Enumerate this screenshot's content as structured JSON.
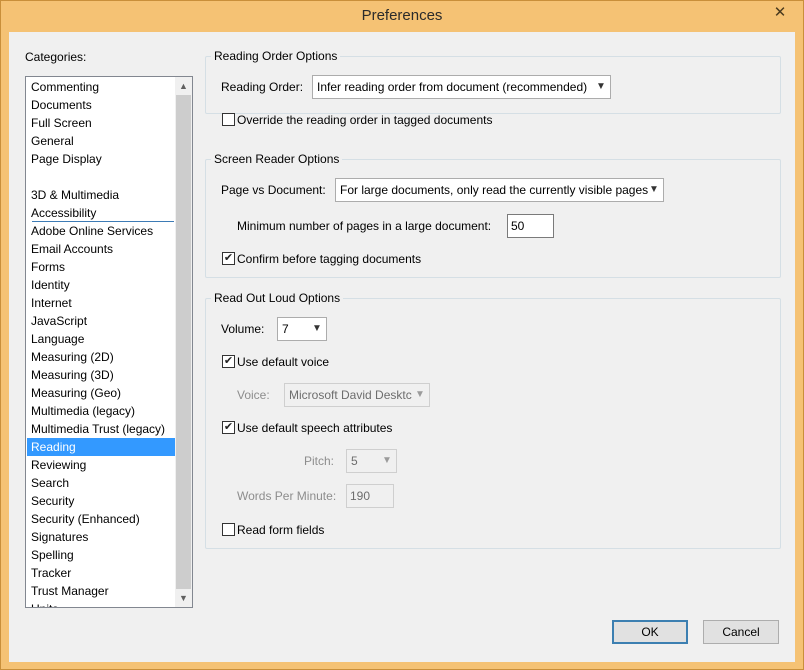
{
  "window": {
    "title": "Preferences",
    "close_icon": "close-icon"
  },
  "categories": {
    "label": "Categories:",
    "top_items": [
      "Commenting",
      "Documents",
      "Full Screen",
      "General",
      "Page Display"
    ],
    "items": [
      "3D & Multimedia",
      "Accessibility",
      "Adobe Online Services",
      "Email Accounts",
      "Forms",
      "Identity",
      "Internet",
      "JavaScript",
      "Language",
      "Measuring (2D)",
      "Measuring (3D)",
      "Measuring (Geo)",
      "Multimedia (legacy)",
      "Multimedia Trust (legacy)",
      "Reading",
      "Reviewing",
      "Search",
      "Security",
      "Security (Enhanced)",
      "Signatures",
      "Spelling",
      "Tracker",
      "Trust Manager",
      "Units"
    ],
    "selected": "Reading"
  },
  "reading_order": {
    "group_title": "Reading Order Options",
    "label": "Reading Order:",
    "value": "Infer reading order from document (recommended)",
    "override_label": "Override the reading order in tagged documents",
    "override_checked": false
  },
  "screen_reader": {
    "group_title": "Screen Reader Options",
    "page_vs_doc_label": "Page vs Document:",
    "page_vs_doc_value": "For large documents, only read the currently visible pages",
    "min_pages_label": "Minimum number of pages in a large document:",
    "min_pages_value": "50",
    "confirm_label": "Confirm before tagging documents",
    "confirm_checked": true
  },
  "read_out_loud": {
    "group_title": "Read Out Loud Options",
    "volume_label": "Volume:",
    "volume_value": "7",
    "default_voice_label": "Use default voice",
    "default_voice_checked": true,
    "voice_label": "Voice:",
    "voice_value": "Microsoft David Desktc",
    "default_speech_label": "Use default speech attributes",
    "default_speech_checked": true,
    "pitch_label": "Pitch:",
    "pitch_value": "5",
    "wpm_label": "Words Per Minute:",
    "wpm_value": "190",
    "form_fields_label": "Read form fields",
    "form_fields_checked": false
  },
  "buttons": {
    "ok": "OK",
    "cancel": "Cancel"
  },
  "colors": {
    "selection": "#3399ff",
    "titlebar": "#f5c274"
  }
}
